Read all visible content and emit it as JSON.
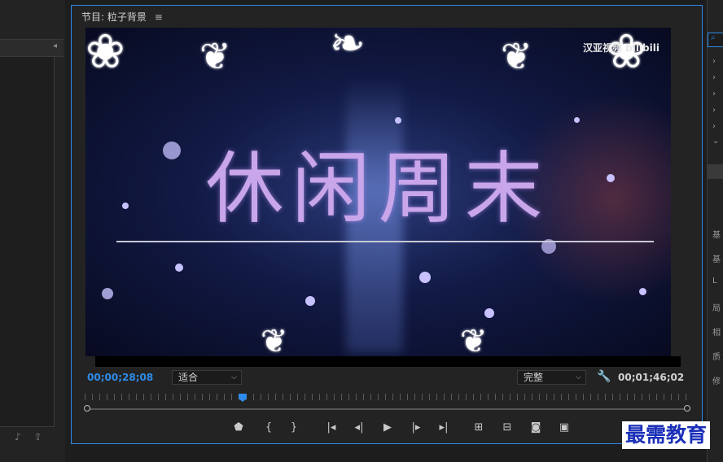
{
  "monitor": {
    "title": "节目: 粒子背景",
    "menu_icon": "≡"
  },
  "video": {
    "headline": "休闲周末",
    "watermark": "汉亚视频 bilibili"
  },
  "status": {
    "current_timecode": "00;00;28;08",
    "fit_dropdown": "适合",
    "quality_dropdown": "完整",
    "duration_timecode": "00;01;46;02"
  },
  "controls": [
    {
      "name": "add-marker-icon",
      "glyph": "⬟"
    },
    {
      "name": "mark-in-icon",
      "glyph": "{"
    },
    {
      "name": "mark-out-icon",
      "glyph": "}"
    },
    {
      "name": "go-to-in-icon",
      "glyph": "|◂"
    },
    {
      "name": "step-back-icon",
      "glyph": "◂|"
    },
    {
      "name": "play-icon",
      "glyph": "▶"
    },
    {
      "name": "step-forward-icon",
      "glyph": "|▸"
    },
    {
      "name": "go-to-out-icon",
      "glyph": "▸|"
    },
    {
      "name": "lift-icon",
      "glyph": "⊞"
    },
    {
      "name": "extract-icon",
      "glyph": "⊟"
    },
    {
      "name": "export-frame-icon",
      "glyph": "◙"
    },
    {
      "name": "comparison-view-icon",
      "glyph": "▣"
    }
  ],
  "right_panel": {
    "items": [
      "基",
      "基",
      "L",
      "局",
      "相",
      "质",
      "修"
    ]
  },
  "brand": {
    "text": "最需教育"
  },
  "colors": {
    "accent": "#2d8ceb",
    "panel_bg": "#232323",
    "headline": "#c9a6ea",
    "brand": "#1a2fb8"
  }
}
